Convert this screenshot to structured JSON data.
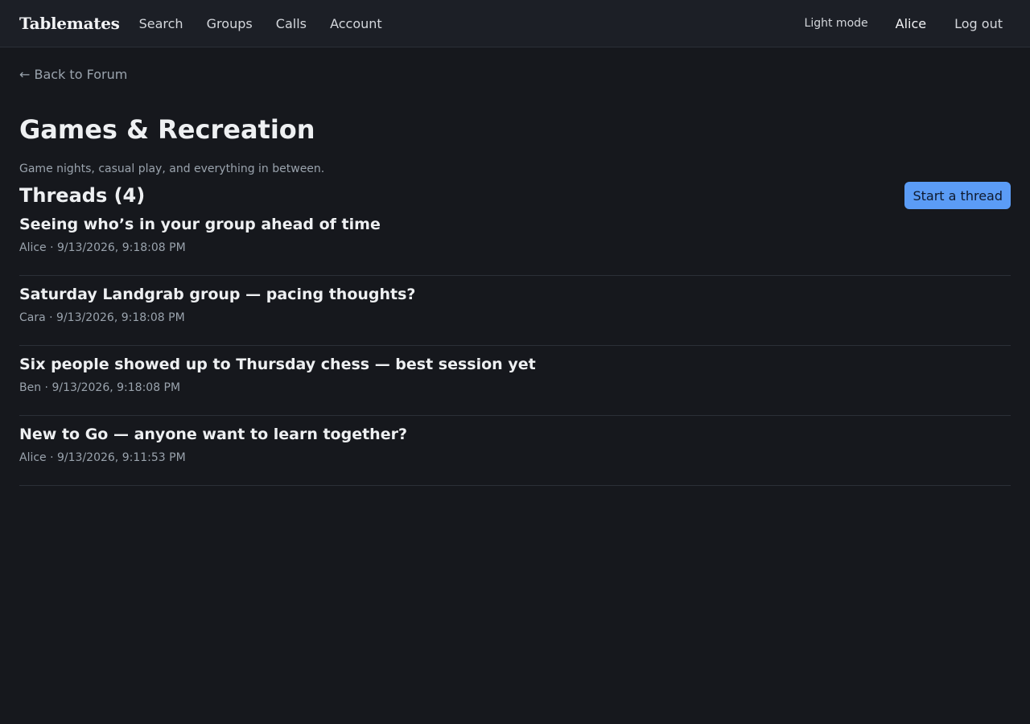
{
  "header": {
    "brand": "Tablemates",
    "nav": [
      "Search",
      "Groups",
      "Calls",
      "Account"
    ],
    "mode_toggle": "Light mode",
    "user": "Alice",
    "logout": "Log out"
  },
  "main": {
    "back_link": "← Back to Forum",
    "title": "Games & Recreation",
    "subtitle": "Game nights, casual play, and everything in between.",
    "threads_heading": "Threads (4)",
    "start_button": "Start a thread",
    "threads": [
      {
        "title": "Seeing who’s in your group ahead of time",
        "meta": "Alice · 9/13/2026, 9:18:08 PM"
      },
      {
        "title": "Saturday Landgrab group — pacing thoughts?",
        "meta": "Cara · 9/13/2026, 9:18:08 PM"
      },
      {
        "title": "Six people showed up to Thursday chess — best session yet",
        "meta": "Ben · 9/13/2026, 9:18:08 PM"
      },
      {
        "title": "New to Go — anyone want to learn together?",
        "meta": "Alice · 9/13/2026, 9:11:53 PM"
      }
    ]
  },
  "colors": {
    "background": "#16181d",
    "header_background": "#1c1f26",
    "accent": "#5b9cf6"
  }
}
